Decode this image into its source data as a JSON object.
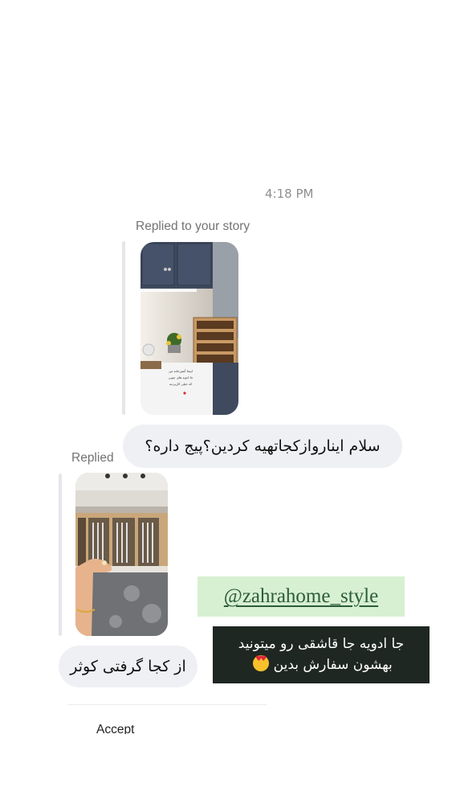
{
  "thread": {
    "timestamp": "4:18 PM",
    "story_reply_1": {
      "label": "Replied to your story",
      "story_overlay_lines": [
        "اینجا آشپزخانه من",
        "جا ادویه های چوبی",
        "که خیلی کاربردیه"
      ],
      "message": "سلام ایناروازکجاتهیه کردین؟پیج داره؟"
    },
    "story_reply_2": {
      "label": "Replied",
      "message": "از کجا گرفتی کوثر"
    },
    "accept_prompt": "Accept message requests"
  },
  "overlay": {
    "mention": "@zahrahome_style",
    "caption_line1": "جا ادویه جا قاشقی رو میتونید",
    "caption_line2": "بهشون سفارش بدین",
    "caption_emoji": "heart-eyes-emoji"
  },
  "colors": {
    "bubble_bg": "#eef0f4",
    "mention_bg": "#d7f0d1",
    "mention_text": "#2c5c3c",
    "caption_bg": "#1f2723"
  }
}
